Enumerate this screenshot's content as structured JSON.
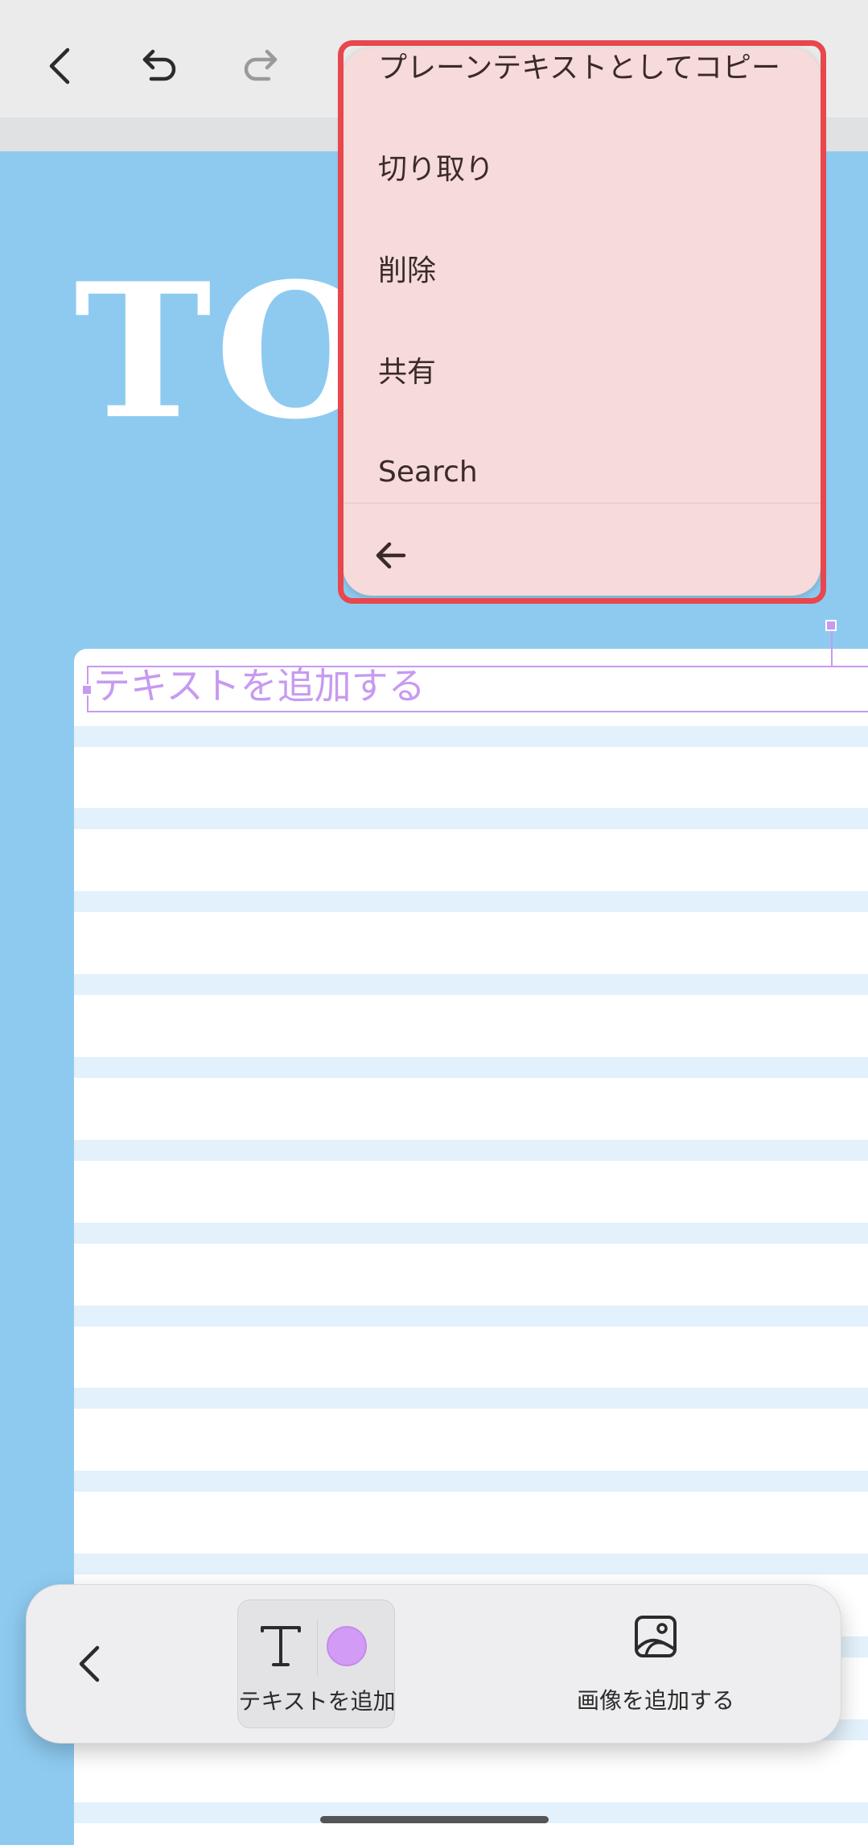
{
  "canvas": {
    "title_text": "TO",
    "textbox_placeholder": "テキストを追加する"
  },
  "context_menu": {
    "items": [
      {
        "label": "プレーンテキストとしてコピー"
      },
      {
        "label": "切り取り"
      },
      {
        "label": "削除"
      },
      {
        "label": "共有"
      },
      {
        "label": "Search"
      }
    ]
  },
  "bottom_toolbar": {
    "add_text_label": "テキストを追加",
    "add_image_label": "画像を追加する"
  },
  "icons": [
    "back-chevron-icon",
    "undo-icon",
    "redo-icon",
    "back-arrow-icon",
    "text-tool-icon",
    "image-icon"
  ],
  "colors": {
    "canvas_bg": "#8ecaf0",
    "menu_bg": "#f7dada",
    "highlight": "#e8474d",
    "accent_purple": "#c79af0"
  }
}
